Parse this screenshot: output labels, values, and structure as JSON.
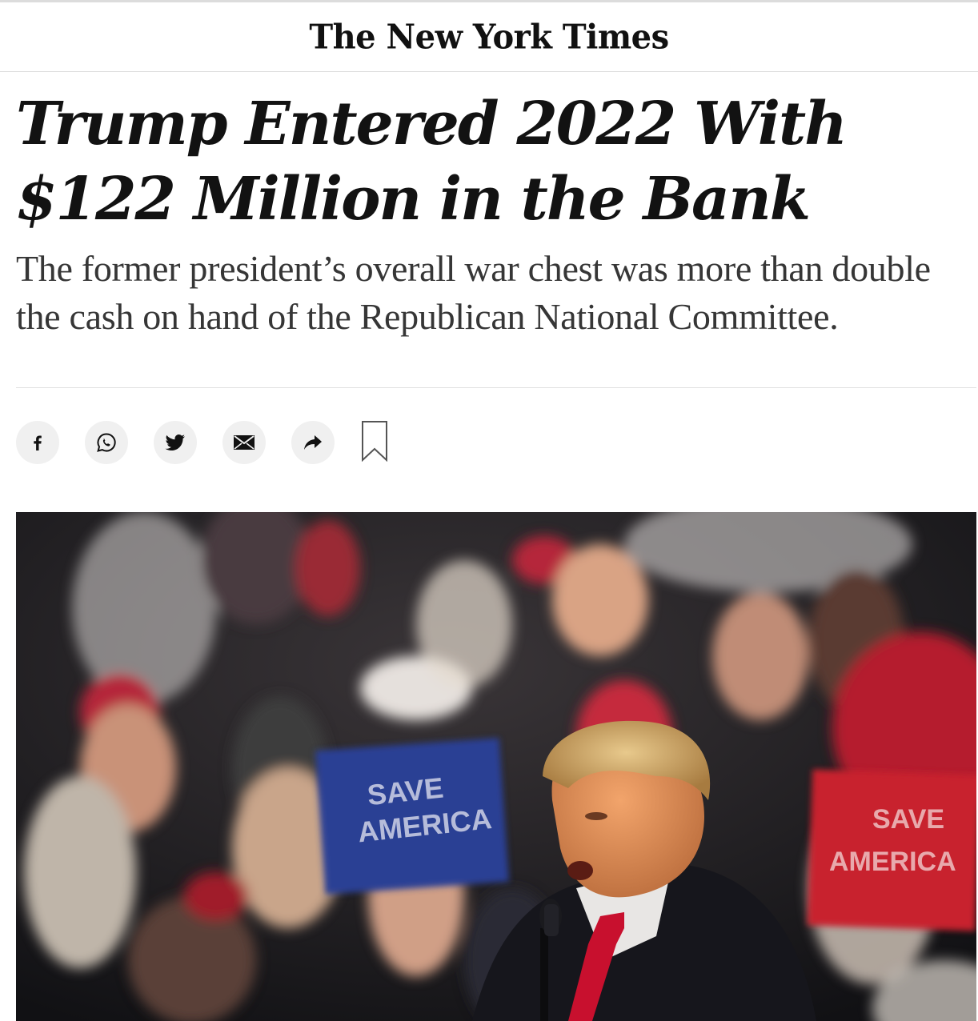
{
  "masthead": {
    "logo_text": "The New York Times"
  },
  "article": {
    "headline": "Trump Entered 2022 With $122 Million in the Bank",
    "summary": "The former president’s overall war chest was more than double the cash on hand of the Republican National Committee."
  },
  "share_tools": [
    {
      "name": "facebook",
      "icon": "facebook-icon"
    },
    {
      "name": "whatsapp",
      "icon": "whatsapp-icon"
    },
    {
      "name": "twitter",
      "icon": "twitter-icon"
    },
    {
      "name": "email",
      "icon": "email-icon"
    },
    {
      "name": "share",
      "icon": "share-arrow-icon"
    },
    {
      "name": "save",
      "icon": "bookmark-icon"
    }
  ],
  "photo": {
    "sign_left_line1": "SAVE",
    "sign_left_line2": "AMERICA",
    "sign_right_line1": "SAVE",
    "sign_right_line2": "AMERICA"
  },
  "colors": {
    "text": "#121212",
    "summary_text": "#363636",
    "share_button_bg": "#f0f0f0",
    "divider": "#e2e2e2"
  }
}
